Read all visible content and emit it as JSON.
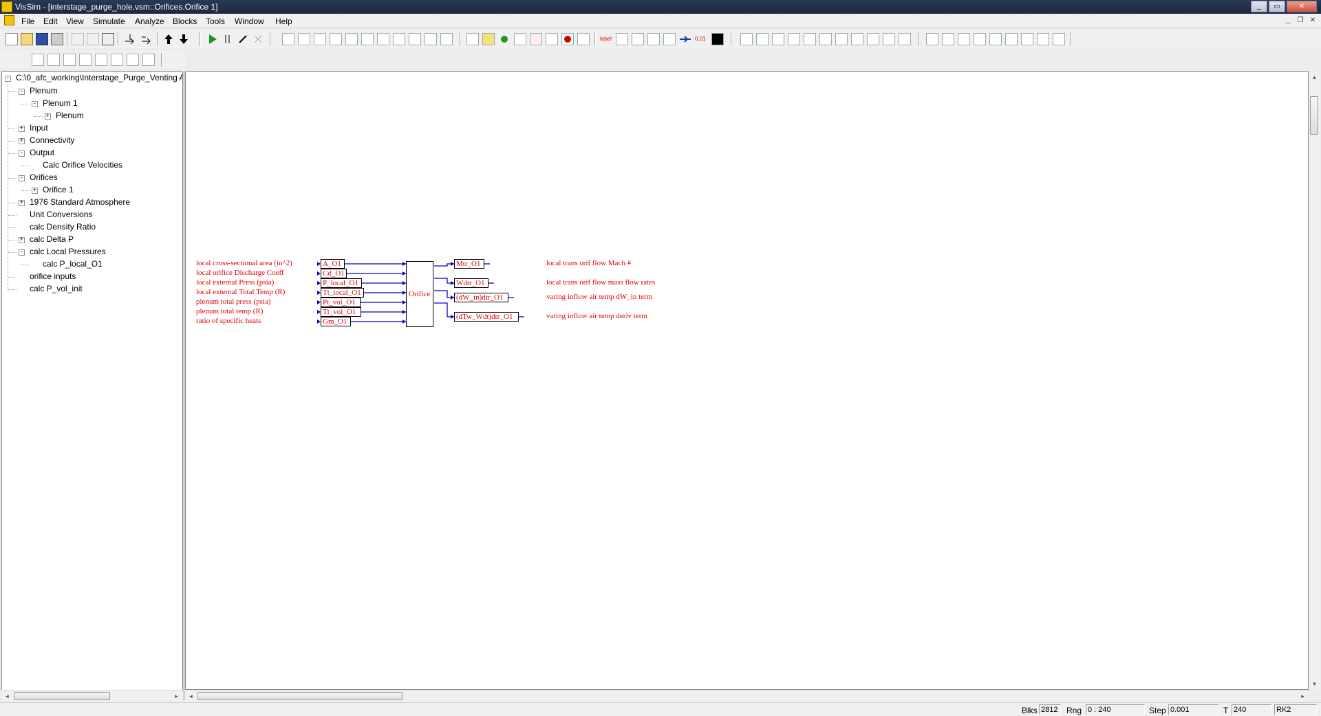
{
  "window": {
    "title": "VisSim - [interstage_purge_hole.vsm::Orifices.Orifice 1]",
    "minimize": "0",
    "maximize": "1",
    "close": "r"
  },
  "menu": [
    "File",
    "Edit",
    "View",
    "Simulate",
    "Analyze",
    "Blocks",
    "Tools",
    "Window",
    "Help"
  ],
  "tree": {
    "root": "C:\\0_afc_working\\Interstage_Purge_Venting A",
    "items": [
      {
        "label": "Plenum",
        "level": 1,
        "expander": "-"
      },
      {
        "label": "Plenum 1",
        "level": 2,
        "expander": "-"
      },
      {
        "label": "Plenum",
        "level": 3,
        "expander": "+"
      },
      {
        "label": "Input",
        "level": 1,
        "expander": "+"
      },
      {
        "label": "Connectivity",
        "level": 1,
        "expander": "+"
      },
      {
        "label": "Output",
        "level": 1,
        "expander": "-"
      },
      {
        "label": "Calc Orifice Velocities",
        "level": 2,
        "expander": ""
      },
      {
        "label": "Orifices",
        "level": 1,
        "expander": "-"
      },
      {
        "label": "Orifice 1",
        "level": 2,
        "expander": "+"
      },
      {
        "label": "1976 Standard Atmosphere",
        "level": 1,
        "expander": "+"
      },
      {
        "label": "Unit Conversions",
        "level": 1,
        "expander": ""
      },
      {
        "label": "calc Density Ratio",
        "level": 1,
        "expander": ""
      },
      {
        "label": "calc Delta P",
        "level": 1,
        "expander": "+"
      },
      {
        "label": "calc Local Pressures",
        "level": 1,
        "expander": "-"
      },
      {
        "label": "calc P_local_O1",
        "level": 2,
        "expander": ""
      },
      {
        "label": "orifice inputs",
        "level": 1,
        "expander": ""
      },
      {
        "label": "calc P_vol_init",
        "level": 1,
        "expander": ""
      }
    ]
  },
  "diagram": {
    "inputs": [
      {
        "label": "local cross-sectional area (in^2)",
        "var": "A_O1"
      },
      {
        "label": "local orifice Discharge Coeff",
        "var": "Cd_O1"
      },
      {
        "label": "local external Press (psia)",
        "var": "P_local_O1"
      },
      {
        "label": "local external Total Temp (R)",
        "var": "Tt_local_O1"
      },
      {
        "label": "plenum total press (psia)",
        "var": "Pt_vol_O1"
      },
      {
        "label": "plenum total temp (R)",
        "var": "Tt_vol_O1"
      },
      {
        "label": "ratio of specific heats",
        "var": "Gm_O1"
      }
    ],
    "block_label": "Orifice",
    "outputs": [
      {
        "var": "Mtr_O1",
        "label": "local trans orif flow Mach #"
      },
      {
        "var": "Wdtr_O1",
        "label": "local trans orif flow mass flow rates"
      },
      {
        "var": "(dW_in)dtr_O1",
        "label": "varing inflow air temp dW_in term"
      },
      {
        "var": "(dTw_Wdt)dtr_O1",
        "label": "varing inflow air temp deriv term"
      }
    ]
  },
  "toolbar": {
    "label_text": "label",
    "out_text": "0.0",
    "out_subtext": "1"
  },
  "status": {
    "blks_label": "Blks",
    "blks": "2812",
    "rng_label": "Rng",
    "rng": "0 : 240",
    "step_label": "Step",
    "step": "0.001",
    "t_label": "T",
    "t": "240",
    "method": "RK2"
  },
  "colors": {
    "wire": "#0000cc",
    "text_red": "#e00000"
  }
}
